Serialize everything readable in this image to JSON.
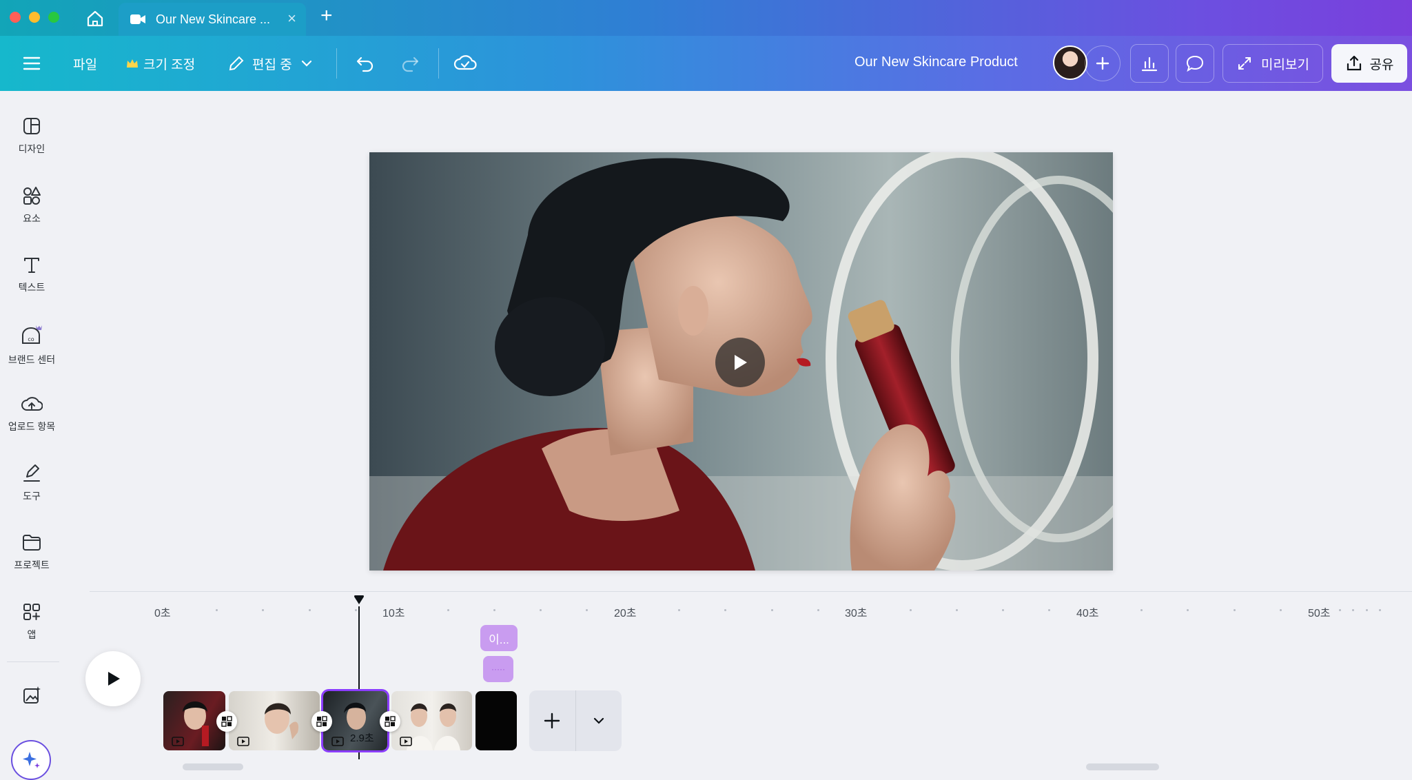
{
  "window": {
    "tab_title": "Our New Skincare ...",
    "tab_close": "×",
    "new_tab": "+",
    "traffic_colors": [
      "#ff5f57",
      "#febc2e",
      "#28c840"
    ]
  },
  "toolbar": {
    "file": "파일",
    "resize": "크기 조정",
    "editing": "편집 중",
    "doc_title": "Our New Skincare Product",
    "preview": "미리보기",
    "share": "공유"
  },
  "sidebar": {
    "items": [
      {
        "label": "디자인",
        "icon": "layout-icon"
      },
      {
        "label": "요소",
        "icon": "shapes-icon"
      },
      {
        "label": "텍스트",
        "icon": "text-icon"
      },
      {
        "label": "브랜드 센터",
        "icon": "brand-icon"
      },
      {
        "label": "업로드 항목",
        "icon": "cloud-upload-icon"
      },
      {
        "label": "도구",
        "icon": "pen-icon"
      },
      {
        "label": "프로젝트",
        "icon": "folder-icon"
      },
      {
        "label": "앱",
        "icon": "apps-icon"
      }
    ]
  },
  "timeline": {
    "ticks": [
      "0초",
      "10초",
      "20초",
      "30초",
      "40초",
      "50초"
    ],
    "selected_clip_duration": "2.9초",
    "text_pill": "이...",
    "audio_pill": "·····"
  },
  "colors": {
    "accent": "#7d2ae8",
    "selected_clip_border": "#8b3dff",
    "pill": "#c99cf0"
  }
}
